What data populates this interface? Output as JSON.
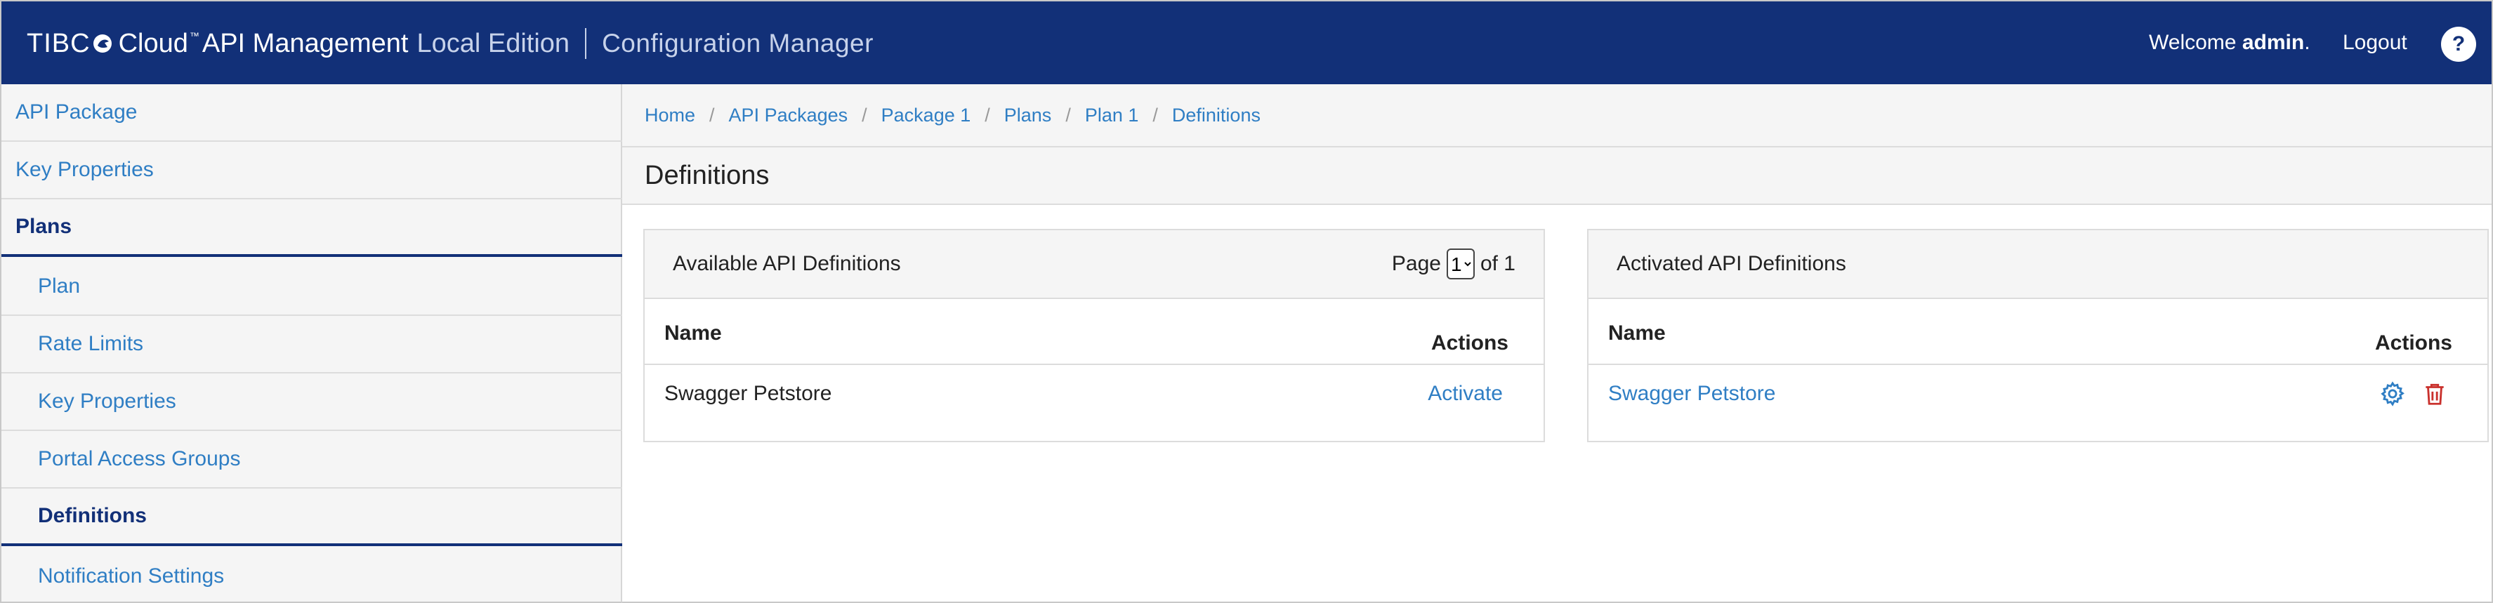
{
  "header": {
    "brand_tibco": "TIBC",
    "brand_cloud": "Cloud",
    "brand_tm": "™",
    "brand_apim": "API Management",
    "brand_edition": "Local Edition",
    "app_name": "Configuration Manager",
    "welcome_prefix": "Welcome",
    "username": "admin",
    "welcome_suffix": ".",
    "logout_label": "Logout",
    "help_label": "?"
  },
  "sidebar": {
    "items": [
      {
        "label": "API Package"
      },
      {
        "label": "Key Properties"
      },
      {
        "label": "Plans"
      },
      {
        "label": "Plan"
      },
      {
        "label": "Rate Limits"
      },
      {
        "label": "Key Properties"
      },
      {
        "label": "Portal Access Groups"
      },
      {
        "label": "Definitions"
      },
      {
        "label": "Notification Settings"
      }
    ]
  },
  "breadcrumb": [
    "Home",
    "API Packages",
    "Package 1",
    "Plans",
    "Plan 1",
    "Definitions"
  ],
  "page_title": "Definitions",
  "available": {
    "title": "Available API Definitions",
    "page_label": "Page",
    "page_value": "1",
    "of_label": "of 1",
    "col_name": "Name",
    "col_actions": "Actions",
    "rows": [
      {
        "name": "Swagger Petstore",
        "action": "Activate"
      }
    ]
  },
  "activated": {
    "title": "Activated API Definitions",
    "col_name": "Name",
    "col_actions": "Actions",
    "rows": [
      {
        "name": "Swagger Petstore"
      }
    ]
  },
  "icons": {
    "settings": "gear-icon",
    "delete": "trash-icon"
  },
  "colors": {
    "header_bg": "#123078",
    "link": "#2f7ec4",
    "delete": "#c9302c"
  }
}
